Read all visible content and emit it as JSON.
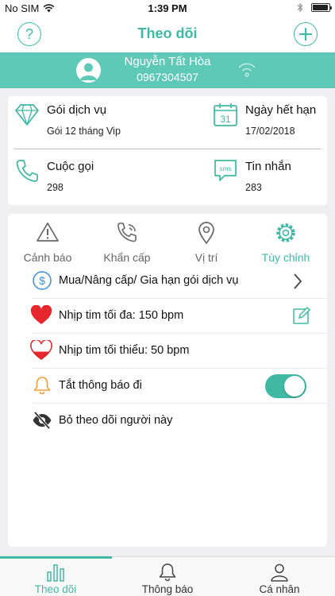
{
  "status_bar": {
    "carrier": "No SIM",
    "time": "1:39 PM"
  },
  "header": {
    "title": "Theo dõi"
  },
  "profile": {
    "name": "Nguyễn Tất Hòa",
    "phone": "0967304507"
  },
  "info": {
    "package_label": "Gói dịch vụ",
    "package_value": "Gói 12 tháng Vip",
    "expiry_label": "Ngày hết hạn",
    "expiry_value": "17/02/2018",
    "calendar_day": "31",
    "calls_label": "Cuộc gọi",
    "calls_value": "298",
    "sms_label": "Tin nhắn",
    "sms_value": "283",
    "sms_icon_text": "sms"
  },
  "tabs": [
    {
      "label": "Cảnh báo",
      "icon": "warning-icon"
    },
    {
      "label": "Khẩn cấp",
      "icon": "emergency-phone-icon"
    },
    {
      "label": "Vị trí",
      "icon": "location-pin-icon"
    },
    {
      "label": "Tùy chỉnh",
      "icon": "gear-icon",
      "active": true
    }
  ],
  "settings": [
    {
      "label": "Mua/Nâng cấp/ Gia hạn gói dịch vụ",
      "icon": "dollar-icon",
      "action": "chevron-right-icon"
    },
    {
      "label": "Nhịp tim tối đa: 150 bpm",
      "icon": "heart-filled-icon",
      "action": "edit-icon"
    },
    {
      "label": "Nhịp tim tối thiểu: 50 bpm",
      "icon": "heart-half-icon"
    },
    {
      "label": "Tắt thông báo đi",
      "icon": "bell-icon",
      "action": "toggle",
      "toggle_on": true
    },
    {
      "label": "Bỏ theo dõi người này",
      "icon": "eye-off-icon"
    }
  ],
  "bottom_tabs": [
    {
      "label": "Theo dõi",
      "icon": "chart-bars-icon",
      "active": true
    },
    {
      "label": "Thông báo",
      "icon": "bell-icon"
    },
    {
      "label": "Cá nhân",
      "icon": "person-icon"
    }
  ],
  "colors": {
    "accent": "#3fb8a4",
    "profile_bg": "#5fc9b8",
    "heart": "#e8262d",
    "bell": "#f0a038",
    "dollar": "#3a8fd8"
  }
}
